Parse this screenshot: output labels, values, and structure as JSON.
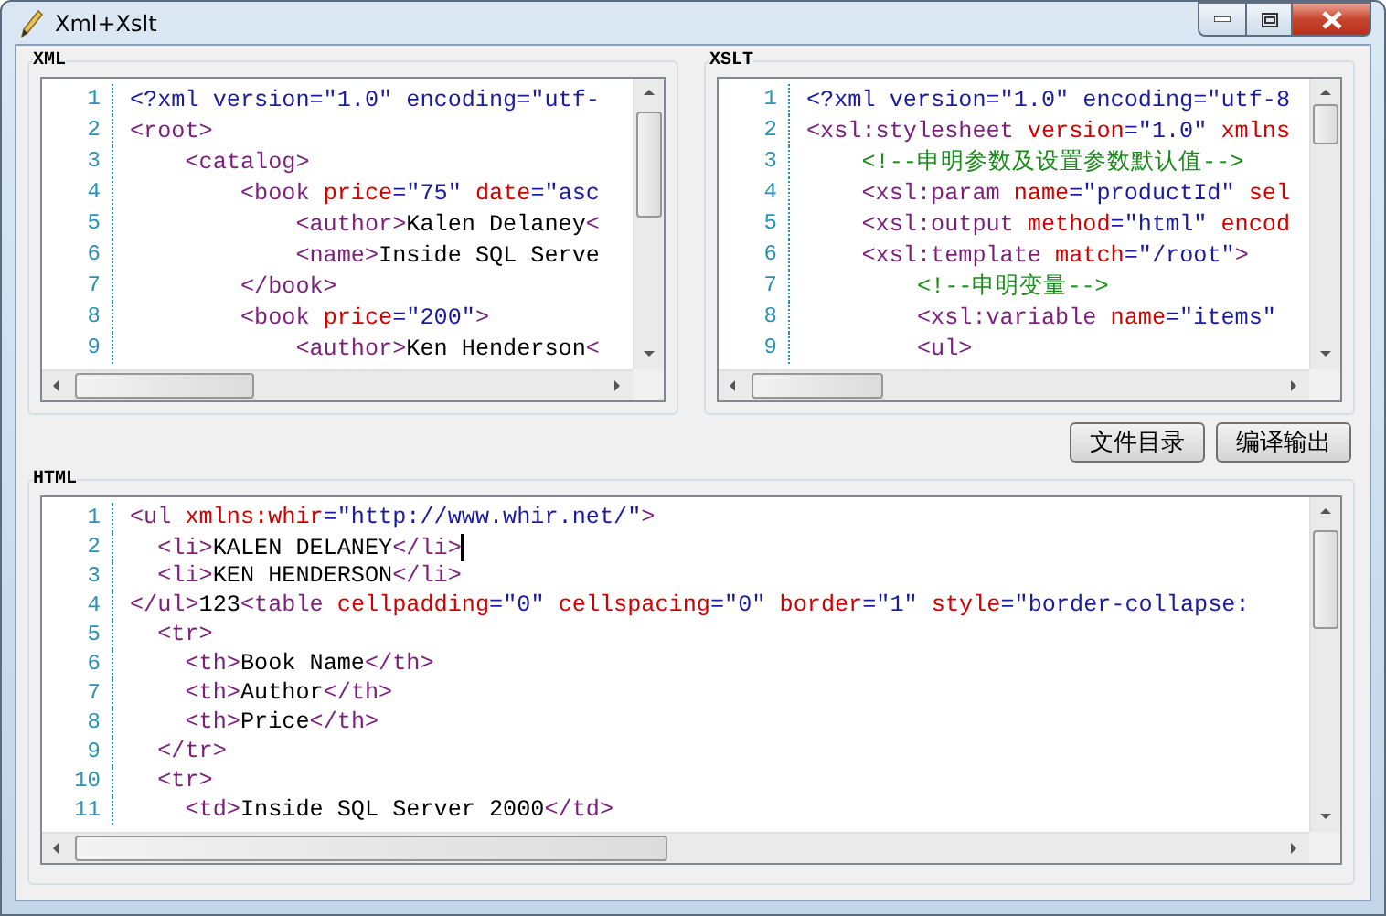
{
  "window": {
    "title": "Xml+Xslt"
  },
  "xml": {
    "label": "XML",
    "lines": [
      {
        "number": "1",
        "caret": false,
        "tokens": [
          {
            "kind": "pi",
            "text": "<?xml version=\"1.0\" encoding=\"utf-"
          }
        ]
      },
      {
        "number": "2",
        "caret": false,
        "tokens": [
          {
            "kind": "tag",
            "text": "<root>"
          }
        ]
      },
      {
        "number": "3",
        "caret": false,
        "tokens": [
          {
            "kind": "tag",
            "text": "    <catalog>"
          }
        ]
      },
      {
        "number": "4",
        "caret": false,
        "tokens": [
          {
            "kind": "tag",
            "text": "        <book "
          },
          {
            "kind": "attr",
            "text": "price"
          },
          {
            "kind": "value",
            "text": "=\"75\" "
          },
          {
            "kind": "attr",
            "text": "date"
          },
          {
            "kind": "value",
            "text": "=\"asc"
          }
        ]
      },
      {
        "number": "5",
        "caret": false,
        "tokens": [
          {
            "kind": "tag",
            "text": "            <author>"
          },
          {
            "kind": "text",
            "text": "Kalen Delaney"
          },
          {
            "kind": "tag",
            "text": "<"
          }
        ]
      },
      {
        "number": "6",
        "caret": false,
        "tokens": [
          {
            "kind": "tag",
            "text": "            <name>"
          },
          {
            "kind": "text",
            "text": "Inside SQL Serve"
          }
        ]
      },
      {
        "number": "7",
        "caret": false,
        "tokens": [
          {
            "kind": "tag",
            "text": "        </book>"
          }
        ]
      },
      {
        "number": "8",
        "caret": false,
        "tokens": [
          {
            "kind": "tag",
            "text": "        <book "
          },
          {
            "kind": "attr",
            "text": "price"
          },
          {
            "kind": "value",
            "text": "=\"200\""
          },
          {
            "kind": "tag",
            "text": ">"
          }
        ]
      },
      {
        "number": "9",
        "caret": false,
        "tokens": [
          {
            "kind": "tag",
            "text": "            <author>"
          },
          {
            "kind": "text",
            "text": "Ken Henderson"
          },
          {
            "kind": "tag",
            "text": "<"
          }
        ]
      }
    ]
  },
  "xslt": {
    "label": "XSLT",
    "lines": [
      {
        "number": "1",
        "caret": false,
        "tokens": [
          {
            "kind": "pi",
            "text": "<?xml version=\"1.0\" encoding=\"utf-8"
          }
        ]
      },
      {
        "number": "2",
        "caret": false,
        "tokens": [
          {
            "kind": "tag",
            "text": "<xsl:stylesheet "
          },
          {
            "kind": "attr",
            "text": "version"
          },
          {
            "kind": "value",
            "text": "=\"1.0\" "
          },
          {
            "kind": "attr",
            "text": "xmlns"
          }
        ]
      },
      {
        "number": "3",
        "caret": false,
        "tokens": [
          {
            "kind": "comment",
            "text": "    <!--申明参数及设置参数默认值-->"
          }
        ]
      },
      {
        "number": "4",
        "caret": false,
        "tokens": [
          {
            "kind": "tag",
            "text": "    <xsl:param "
          },
          {
            "kind": "attr",
            "text": "name"
          },
          {
            "kind": "value",
            "text": "=\"productId\" "
          },
          {
            "kind": "attr",
            "text": "sel"
          }
        ]
      },
      {
        "number": "5",
        "caret": false,
        "tokens": [
          {
            "kind": "tag",
            "text": "    <xsl:output "
          },
          {
            "kind": "attr",
            "text": "method"
          },
          {
            "kind": "value",
            "text": "=\"html\" "
          },
          {
            "kind": "attr",
            "text": "encod"
          }
        ]
      },
      {
        "number": "6",
        "caret": false,
        "tokens": [
          {
            "kind": "tag",
            "text": "    <xsl:template "
          },
          {
            "kind": "attr",
            "text": "match"
          },
          {
            "kind": "value",
            "text": "=\"/root\""
          },
          {
            "kind": "tag",
            "text": ">"
          }
        ]
      },
      {
        "number": "7",
        "caret": false,
        "tokens": [
          {
            "kind": "comment",
            "text": "        <!--申明变量-->"
          }
        ]
      },
      {
        "number": "8",
        "caret": false,
        "tokens": [
          {
            "kind": "tag",
            "text": "        <xsl:variable "
          },
          {
            "kind": "attr",
            "text": "name"
          },
          {
            "kind": "value",
            "text": "=\"items\""
          }
        ]
      },
      {
        "number": "9",
        "caret": false,
        "tokens": [
          {
            "kind": "tag",
            "text": "        <ul>"
          }
        ]
      }
    ]
  },
  "buttons": [
    "文件目录",
    "编译输出"
  ],
  "html": {
    "label": "HTML",
    "lines": [
      {
        "number": "1",
        "caret": false,
        "tokens": [
          {
            "kind": "tag",
            "text": "<ul "
          },
          {
            "kind": "attr",
            "text": "xmlns:whir"
          },
          {
            "kind": "value",
            "text": "=\"http://www.whir.net/\""
          },
          {
            "kind": "tag",
            "text": ">"
          }
        ]
      },
      {
        "number": "2",
        "caret": true,
        "tokens": [
          {
            "kind": "tag",
            "text": "  <li>"
          },
          {
            "kind": "text",
            "text": "KALEN DELANEY"
          },
          {
            "kind": "tag",
            "text": "</li>"
          }
        ]
      },
      {
        "number": "3",
        "caret": false,
        "tokens": [
          {
            "kind": "tag",
            "text": "  <li>"
          },
          {
            "kind": "text",
            "text": "KEN HENDERSON"
          },
          {
            "kind": "tag",
            "text": "</li>"
          }
        ]
      },
      {
        "number": "4",
        "caret": false,
        "tokens": [
          {
            "kind": "tag",
            "text": "</ul>"
          },
          {
            "kind": "text",
            "text": "123"
          },
          {
            "kind": "tag",
            "text": "<table "
          },
          {
            "kind": "attr",
            "text": "cellpadding"
          },
          {
            "kind": "value",
            "text": "=\"0\" "
          },
          {
            "kind": "attr",
            "text": "cellspacing"
          },
          {
            "kind": "value",
            "text": "=\"0\" "
          },
          {
            "kind": "attr",
            "text": "border"
          },
          {
            "kind": "value",
            "text": "=\"1\" "
          },
          {
            "kind": "attr",
            "text": "style"
          },
          {
            "kind": "value",
            "text": "=\"border-collapse:"
          }
        ]
      },
      {
        "number": "5",
        "caret": false,
        "tokens": [
          {
            "kind": "tag",
            "text": "  <tr>"
          }
        ]
      },
      {
        "number": "6",
        "caret": false,
        "tokens": [
          {
            "kind": "tag",
            "text": "    <th>"
          },
          {
            "kind": "text",
            "text": "Book Name"
          },
          {
            "kind": "tag",
            "text": "</th>"
          }
        ]
      },
      {
        "number": "7",
        "caret": false,
        "tokens": [
          {
            "kind": "tag",
            "text": "    <th>"
          },
          {
            "kind": "text",
            "text": "Author"
          },
          {
            "kind": "tag",
            "text": "</th>"
          }
        ]
      },
      {
        "number": "8",
        "caret": false,
        "tokens": [
          {
            "kind": "tag",
            "text": "    <th>"
          },
          {
            "kind": "text",
            "text": "Price"
          },
          {
            "kind": "tag",
            "text": "</th>"
          }
        ]
      },
      {
        "number": "9",
        "caret": false,
        "tokens": [
          {
            "kind": "tag",
            "text": "  </tr>"
          }
        ]
      },
      {
        "number": "10",
        "caret": false,
        "tokens": [
          {
            "kind": "tag",
            "text": "  <tr>"
          }
        ]
      },
      {
        "number": "11",
        "caret": false,
        "tokens": [
          {
            "kind": "tag",
            "text": "    <td>"
          },
          {
            "kind": "text",
            "text": "Inside SQL Server 2000"
          },
          {
            "kind": "tag",
            "text": "</td>"
          }
        ]
      }
    ]
  }
}
